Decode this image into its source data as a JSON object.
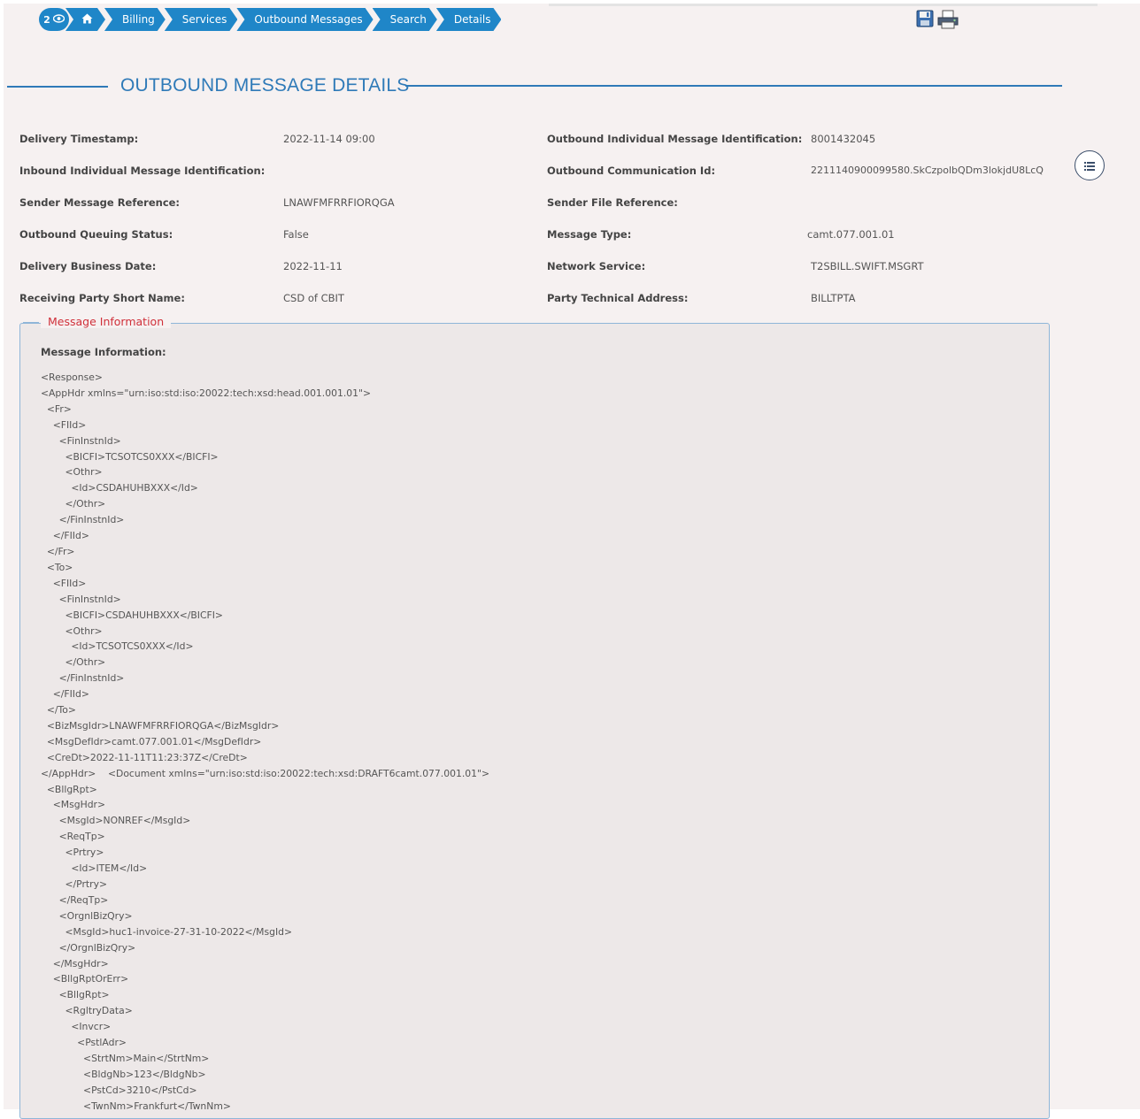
{
  "breadcrumb": {
    "count": "2",
    "items": [
      "Billing",
      "Services",
      "Outbound Messages",
      "Search",
      "Details"
    ]
  },
  "toolbar": {
    "save_icon": "save-icon",
    "print_icon": "print-icon"
  },
  "page_title": "OUTBOUND MESSAGE DETAILS",
  "details": {
    "left": [
      {
        "label": "Delivery Timestamp:",
        "value": "2022-11-14 09:00"
      },
      {
        "label": "Inbound Individual Message Identification:",
        "value": ""
      },
      {
        "label": "Sender Message Reference:",
        "value": "LNAWFMFRRFIORQGA"
      },
      {
        "label": "Outbound Queuing Status:",
        "value": "False"
      },
      {
        "label": "Delivery Business Date:",
        "value": "2022-11-11"
      },
      {
        "label": "Receiving Party Short Name:",
        "value": "CSD of CBIT"
      }
    ],
    "right": [
      {
        "label": "Outbound Individual Message Identification:",
        "value": "8001432045"
      },
      {
        "label": "Outbound Communication Id:",
        "value": "2211140900099580.SkCzpolbQDm3lokjdU8LcQ"
      },
      {
        "label": "Sender File Reference:",
        "value": ""
      },
      {
        "label": "Message Type:",
        "value": "camt.077.001.01"
      },
      {
        "label": "Network Service:",
        "value": "T2SBILL.SWIFT.MSGRT"
      },
      {
        "label": "Party Technical Address:",
        "value": "BILLTPTA"
      }
    ]
  },
  "message_info": {
    "legend": "Message Information",
    "label": "Message Information:",
    "content": "<Response>\n<AppHdr xmlns=\"urn:iso:std:iso:20022:tech:xsd:head.001.001.01\">\n  <Fr>\n    <FIId>\n      <FinInstnId>\n        <BICFI>TCSOTCS0XXX</BICFI>\n        <Othr>\n          <Id>CSDAHUHBXXX</Id>\n        </Othr>\n      </FinInstnId>\n    </FIId>\n  </Fr>\n  <To>\n    <FIId>\n      <FinInstnId>\n        <BICFI>CSDAHUHBXXX</BICFI>\n        <Othr>\n          <Id>TCSOTCS0XXX</Id>\n        </Othr>\n      </FinInstnId>\n    </FIId>\n  </To>\n  <BizMsgIdr>LNAWFMFRRFIORQGA</BizMsgIdr>\n  <MsgDefIdr>camt.077.001.01</MsgDefIdr>\n  <CreDt>2022-11-11T11:23:37Z</CreDt>\n</AppHdr>    <Document xmlns=\"urn:iso:std:iso:20022:tech:xsd:DRAFT6camt.077.001.01\">\n  <BllgRpt>\n    <MsgHdr>\n      <MsgId>NONREF</MsgId>\n      <ReqTp>\n        <Prtry>\n          <Id>ITEM</Id>\n        </Prtry>\n      </ReqTp>\n      <OrgnlBizQry>\n        <MsgId>huc1-invoice-27-31-10-2022</MsgId>\n      </OrgnlBizQry>\n    </MsgHdr>\n    <BllgRptOrErr>\n      <BllgRpt>\n        <RgltryData>\n          <Invcr>\n            <PstlAdr>\n              <StrtNm>Main</StrtNm>\n              <BldgNb>123</BldgNb>\n              <PstCd>3210</PstCd>\n              <TwnNm>Frankfurt</TwnNm>"
  }
}
